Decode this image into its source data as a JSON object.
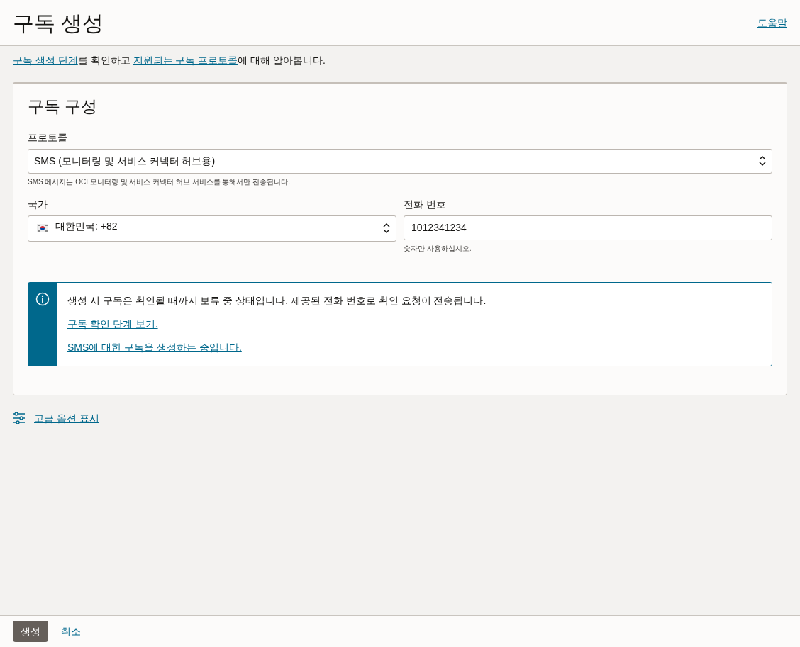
{
  "header": {
    "title": "구독 생성",
    "help_link": "도움말"
  },
  "intro": [
    {
      "kind": "link",
      "text": "구독 생성 단계"
    },
    {
      "kind": "text",
      "text": "를 확인하고 "
    },
    {
      "kind": "link",
      "text": "지원되는 구독 프로토콜"
    },
    {
      "kind": "text",
      "text": "에 대해 알아봅니다."
    }
  ],
  "card": {
    "title": "구독 구성",
    "protocol": {
      "label": "프로토콜",
      "value": "SMS (모니터링 및 서비스 커넥터 허브용)",
      "help": "SMS 메시지는 OCI 모니터링 및 서비스 커넥터 허브 서비스를 통해서만 전송됩니다."
    },
    "country": {
      "label": "국가",
      "value": "대한민국: +82"
    },
    "phone": {
      "label": "전화 번호",
      "value": "1012341234",
      "help": "숫자만 사용하십시오."
    },
    "info": {
      "message": "생성 시 구독은 확인될 때까지 보류 중 상태입니다. 제공된 전화 번호로 확인 요청이 전송됩니다.",
      "links": [
        "구독 확인 단계 보기.",
        "SMS에 대한 구독을 생성하는 중입니다."
      ]
    }
  },
  "advanced_link": "고급 옵션 표시",
  "footer": {
    "primary": "생성",
    "cancel": "취소"
  }
}
